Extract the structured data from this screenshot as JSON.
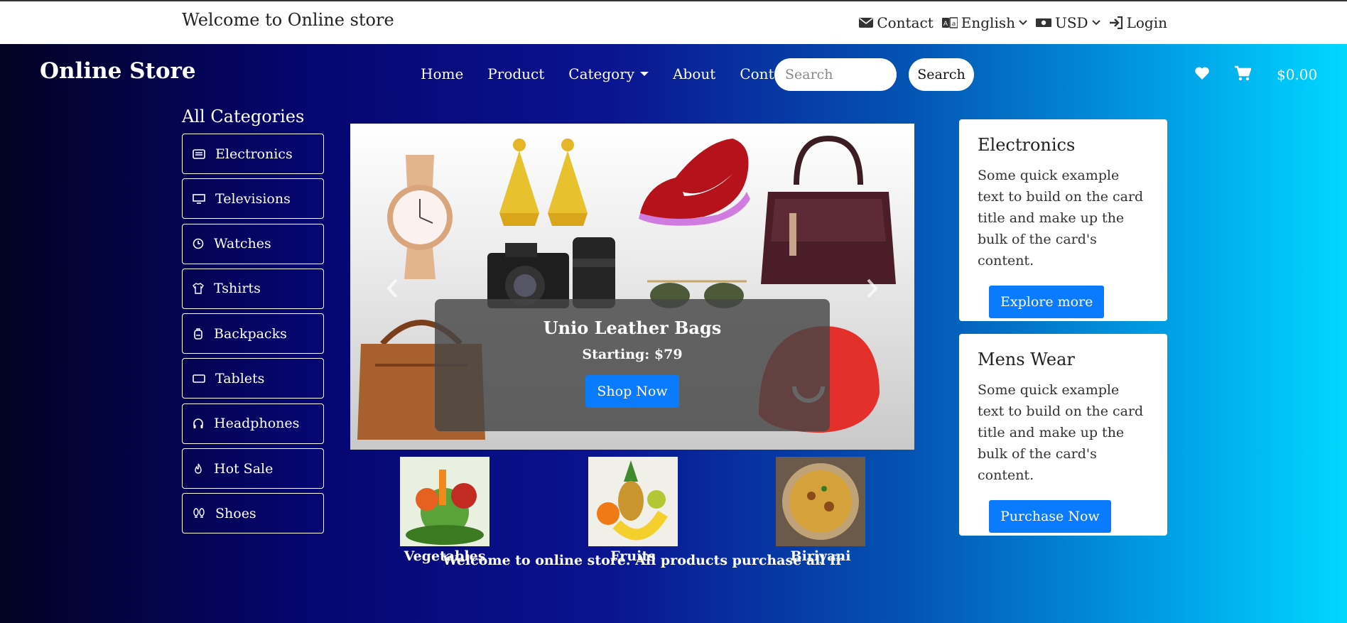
{
  "topbar": {
    "welcome": "Welcome to Online store",
    "contact": "Contact",
    "language": "English",
    "currency": "USD",
    "login": "Login"
  },
  "header": {
    "brand": "Online Store",
    "nav": [
      "Home",
      "Product",
      "Category",
      "About",
      "Contact"
    ],
    "search_placeholder": "Search",
    "search_button": "Search",
    "cart_total": "$0.00"
  },
  "categories": {
    "title": "All Categories",
    "items": [
      {
        "label": "Electronics",
        "icon": "device-icon"
      },
      {
        "label": "Televisions",
        "icon": "tv-icon"
      },
      {
        "label": "Watches",
        "icon": "clock-icon"
      },
      {
        "label": "Tshirts",
        "icon": "shirt-icon"
      },
      {
        "label": "Backpacks",
        "icon": "backpack-icon"
      },
      {
        "label": "Tablets",
        "icon": "tablet-icon"
      },
      {
        "label": "Headphones",
        "icon": "headphones-icon"
      },
      {
        "label": "Hot Sale",
        "icon": "flame-icon"
      },
      {
        "label": "Shoes",
        "icon": "footprints-icon"
      }
    ]
  },
  "carousel": {
    "title": "Unio Leather Bags",
    "subtitle": "Starting: $79",
    "button": "Shop Now",
    "active_slide": 3,
    "slide_count": 3
  },
  "thumbnails": [
    {
      "label": "Vegetables"
    },
    {
      "label": "Fruits"
    },
    {
      "label": "Biriyani"
    }
  ],
  "cards": [
    {
      "title": "Electronics",
      "text": "Some quick example text to build on the card title and make up the bulk of the card's content.",
      "button": "Explore more"
    },
    {
      "title": "Mens Wear",
      "text": "Some quick example text to build on the card title and make up the bulk of the card's content.",
      "button": "Purchase Now"
    }
  ],
  "marquee": "Welcome to online store. All products purchase all from any whe",
  "colors": {
    "accent": "#0a7bff",
    "gradient_start": "#020222",
    "gradient_end": "#00d8ff"
  }
}
